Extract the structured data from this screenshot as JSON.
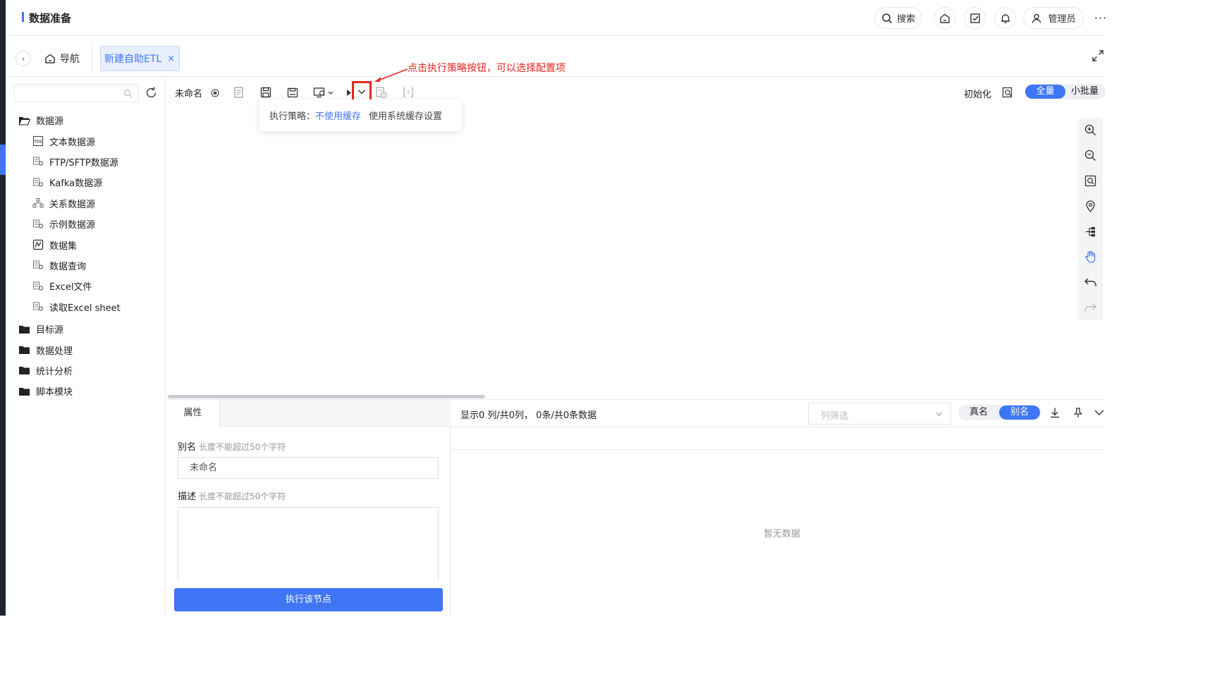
{
  "header": {
    "title": "数据准备",
    "search_label": "搜索",
    "user_label": "管理员",
    "more_label": "···"
  },
  "tabbar": {
    "nav_label": "导航",
    "tabs": [
      {
        "label": "新建自助ETL",
        "close": "×"
      }
    ]
  },
  "sidebar": {
    "search": {
      "value": "",
      "placeholder": ""
    },
    "folders": [
      {
        "label": "数据源",
        "open": true,
        "items": [
          {
            "label": "文本数据源",
            "icon": "tds-icon"
          },
          {
            "label": "FTP/SFTP数据源",
            "icon": "datasource-icon"
          },
          {
            "label": "Kafka数据源",
            "icon": "datasource-icon"
          },
          {
            "label": "关系数据源",
            "icon": "relation-icon"
          },
          {
            "label": "示例数据源",
            "icon": "datasource-icon"
          },
          {
            "label": "数据集",
            "icon": "dataset-icon"
          },
          {
            "label": "数据查询",
            "icon": "datasource-icon"
          },
          {
            "label": "Excel文件",
            "icon": "datasource-icon"
          },
          {
            "label": "读取Excel sheet",
            "icon": "datasource-icon"
          }
        ]
      },
      {
        "label": "目标源",
        "open": false
      },
      {
        "label": "数据处理",
        "open": false
      },
      {
        "label": "统计分析",
        "open": false
      },
      {
        "label": "脚本模块",
        "open": false
      }
    ]
  },
  "toolbar": {
    "name": "未命名",
    "init_label": "初始化",
    "mode_full": "全量",
    "mode_small": "小批量",
    "mode_selected": "全量"
  },
  "annotation": {
    "text": "点击执行策略按钮，可以选择配置项",
    "color": "#e8261c"
  },
  "popover": {
    "label": "执行策略：",
    "option_active": "不使用缓存",
    "option_other": "使用系统缓存设置"
  },
  "properties": {
    "tab_label": "属性",
    "alias_label": "别名",
    "alias_hint": "长度不能超过50个字符",
    "alias_value": "未命名",
    "desc_label": "描述",
    "desc_hint": "长度不能超过50个字符",
    "desc_value": "",
    "run_button": "执行该节点"
  },
  "preview": {
    "summary": "显示0 列/共0列，  0条/共0条数据",
    "filter_placeholder": "列筛选",
    "real_name": "真名",
    "alias_name": "别名",
    "empty_text": "暂无数据"
  },
  "colors": {
    "accent": "#3f76f5",
    "sidebar_dark": "#1f2433",
    "annotation_red": "#e8261c"
  }
}
